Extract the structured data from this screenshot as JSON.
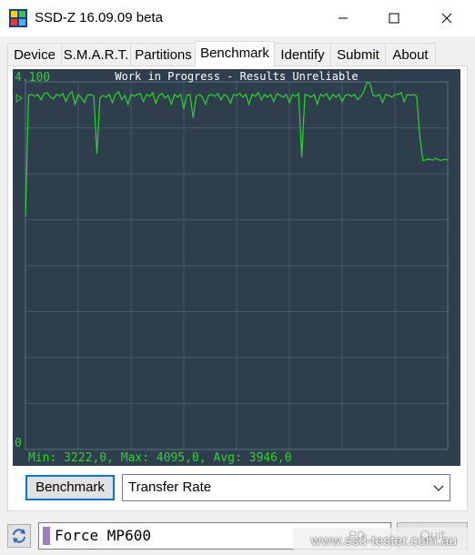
{
  "window": {
    "title": "SSD-Z 16.09.09 beta"
  },
  "tabs": [
    {
      "label": "Device",
      "active": false
    },
    {
      "label": "S.M.A.R.T.",
      "active": false
    },
    {
      "label": "Partitions",
      "active": false
    },
    {
      "label": "Benchmark",
      "active": true
    },
    {
      "label": "Identify",
      "active": false
    },
    {
      "label": "Submit",
      "active": false
    },
    {
      "label": "About",
      "active": false
    }
  ],
  "graph": {
    "banner": "Work in Progress - Results Unreliable",
    "y_top_label": "4.100",
    "y_bottom_label": "0",
    "stats": "Min: 3222,0, Max: 4095,0, Avg: 3946,0",
    "colors": {
      "background": "#2f3e4c",
      "grid": "#44596b",
      "line": "#2bd42b",
      "text": "#2bd42b",
      "banner_text": "#ffffff"
    }
  },
  "chart_data": {
    "type": "line",
    "ylim": [
      0,
      4100
    ],
    "y": [
      2600,
      3950,
      3960,
      3940,
      3960,
      3900,
      3970,
      3980,
      3930,
      3910,
      3960,
      3940,
      3970,
      3880,
      3960,
      3990,
      3850,
      3960,
      3920,
      3870,
      3950,
      3960,
      3940,
      3300,
      3920,
      3950,
      3930,
      3960,
      3870,
      3960,
      3990,
      3900,
      3950,
      3850,
      3960,
      3940,
      3960,
      3970,
      3880,
      3960,
      3940,
      3980,
      3860,
      3950,
      3970,
      3920,
      3950,
      3850,
      3960,
      3930,
      3960,
      3800,
      3950,
      3960,
      3700,
      3940,
      3960,
      3930,
      3850,
      3950,
      3960,
      3940,
      3970,
      3900,
      3960,
      3940,
      3860,
      3960,
      3950,
      3970,
      3930,
      3960,
      3850,
      3960,
      3940,
      3980,
      3900,
      3960,
      3930,
      3960,
      3880,
      3970,
      3950,
      3930,
      3960,
      3870,
      3960,
      3940,
      3970,
      3260,
      3960,
      3950,
      3930,
      3960,
      3850,
      3960,
      3940,
      3970,
      3900,
      3960,
      3930,
      3960,
      3880,
      3950,
      3960,
      3940,
      3960,
      3900,
      3940,
      3990,
      4095,
      4080,
      3950,
      3940,
      3960,
      3870,
      3960,
      3950,
      3930,
      3960,
      3960,
      3980,
      3880,
      3960,
      3950,
      3960,
      3940,
      3500,
      3222,
      3230,
      3240,
      3225,
      3250,
      3230,
      3225,
      3235,
      3228
    ]
  },
  "controls": {
    "benchmark_label": "Benchmark",
    "mode_value": "Transfer Rate"
  },
  "drive": {
    "name": "Force MP600",
    "id": "P0",
    "swatch_color": "#a07cc0"
  },
  "quit_label": "Quit",
  "watermark": "www.ssd-tester.com.au"
}
